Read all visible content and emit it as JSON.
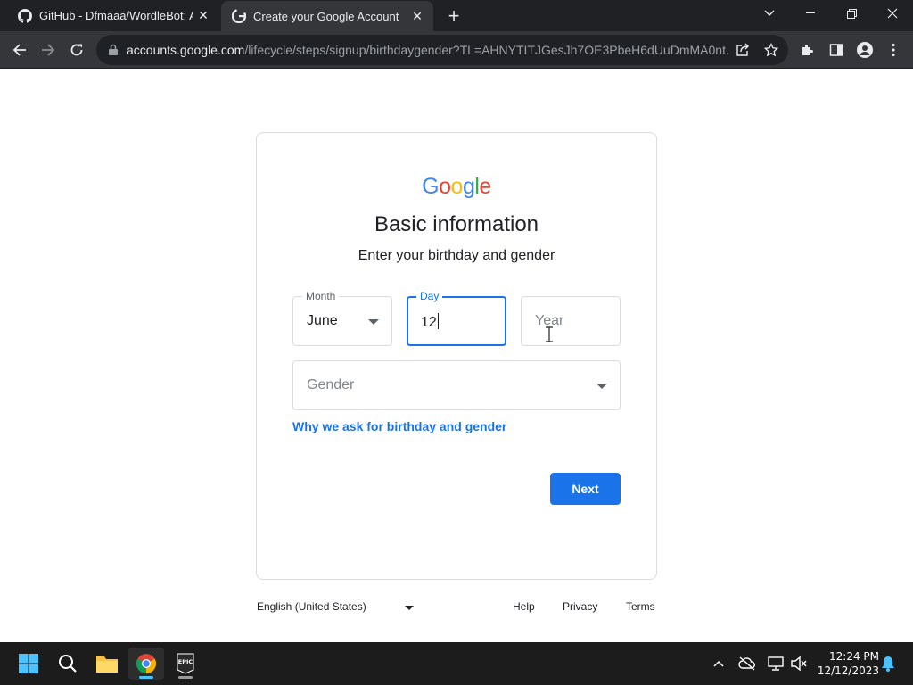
{
  "browser": {
    "tabs": [
      {
        "title": "GitHub - Dfmaaa/WordleBot: A",
        "active": false,
        "icon": "github-icon"
      },
      {
        "title": "Create your Google Account",
        "active": true,
        "icon": "google-icon"
      }
    ],
    "url_host": "accounts.google.com",
    "url_path": "/lifecycle/steps/signup/birthdaygender?TL=AHNYTITJGesJh7OE3PbeH6dUuDmMA0nt..."
  },
  "page": {
    "logo_letters": [
      "G",
      "o",
      "o",
      "g",
      "l",
      "e"
    ],
    "logo_colors": [
      "#4285f4",
      "#ea4335",
      "#fbbc05",
      "#4285f4",
      "#34a853",
      "#ea4335"
    ],
    "title": "Basic information",
    "subtitle": "Enter your birthday and gender",
    "month": {
      "label": "Month",
      "value": "June"
    },
    "day": {
      "label": "Day",
      "value": "12"
    },
    "year": {
      "placeholder": "Year"
    },
    "gender": {
      "placeholder": "Gender"
    },
    "why_link": "Why we ask for birthday and gender",
    "next_label": "Next"
  },
  "footer": {
    "language": "English (United States)",
    "links": [
      "Help",
      "Privacy",
      "Terms"
    ]
  },
  "taskbar": {
    "time": "12:24 PM",
    "date": "12/12/2023"
  },
  "colors": {
    "accent": "#1a73e8",
    "chrome_dark": "#202124",
    "chrome_toolbar": "#35363a",
    "taskbar": "#1c1c1c"
  }
}
